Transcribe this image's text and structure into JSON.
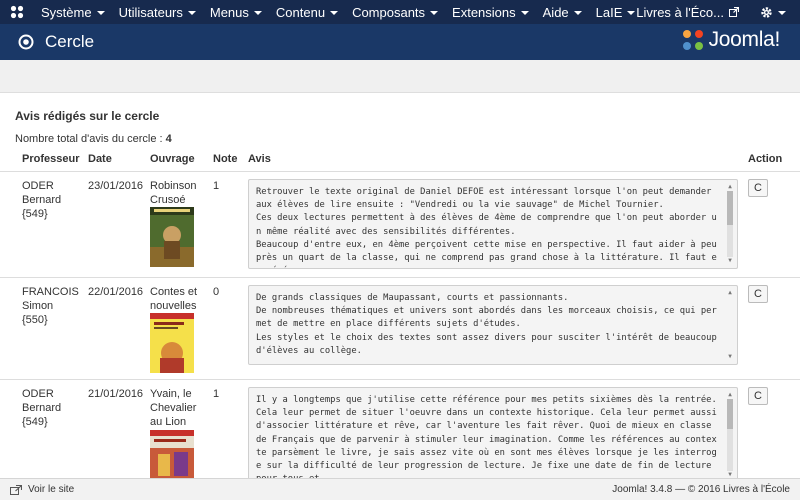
{
  "nav": {
    "logo_icon": "joomla-icon",
    "menus": [
      {
        "label": "Système"
      },
      {
        "label": "Utilisateurs"
      },
      {
        "label": "Menus"
      },
      {
        "label": "Contenu"
      },
      {
        "label": "Composants"
      },
      {
        "label": "Extensions"
      },
      {
        "label": "Aide"
      },
      {
        "label": "LaIE"
      }
    ],
    "site_link": "Livres à l'Éco...",
    "settings_icon": "gear-icon"
  },
  "header": {
    "title": "Cercle",
    "brand": "Joomla!",
    "colors": {
      "navbar": "#172a4e",
      "titlebar": "#1a3867"
    }
  },
  "main": {
    "section_title": "Avis rédigés sur le cercle",
    "total_label": "Nombre total d'avis du cercle :",
    "total_value": "4",
    "columns": {
      "professeur": "Professeur",
      "date": "Date",
      "ouvrage": "Ouvrage",
      "note": "Note",
      "avis": "Avis",
      "action": "Action"
    },
    "rows": [
      {
        "prof_name": "ODER",
        "prof_first": "Bernard",
        "prof_id": "{549}",
        "date": "23/01/2016",
        "book_line1": "Robinson",
        "book_line2": "Crusoé",
        "book_line3": "",
        "note": "1",
        "avis": "Retrouver le texte original de Daniel DEFOE est intéressant lorsque l'on peut demander aux élèves de lire ensuite : \"Vendredi ou la vie sauvage\" de Michel Tournier.\nCes deux lectures permettent à des élèves de 4ème de comprendre que l'on peut aborder un même réalité avec des sensibilités différentes.\nBeaucoup d'entre eux, en 4ème perçoivent cette mise en perspective. Il faut aider à peu près un quart de la classe, qui ne comprend pas grand chose à la littérature. Il faut en génér",
        "action": "C"
      },
      {
        "prof_name": "FRANCOIS",
        "prof_first": "Simon",
        "prof_id": "{550}",
        "date": "22/01/2016",
        "book_line1": "Contes et",
        "book_line2": "nouvelles",
        "book_line3": "",
        "note": "0",
        "avis": "De grands classiques de Maupassant, courts et passionnants.\nDe nombreuses thématiques et univers sont abordés dans les morceaux choisis, ce qui permet de mettre en place différents sujets d'études.\nLes styles et le choix des textes sont assez divers pour susciter l'intérêt de beaucoup d'élèves au collège.",
        "action": "C"
      },
      {
        "prof_name": "ODER",
        "prof_first": "Bernard",
        "prof_id": "{549}",
        "date": "21/01/2016",
        "book_line1": "Yvain, le",
        "book_line2": "Chevalier",
        "book_line3": "au Lion",
        "note": "1",
        "avis": "Il y a longtemps que j'utilise cette référence pour mes petits sixièmes dès la rentrée. Cela leur permet de situer l'oeuvre dans un contexte historique. Cela leur permet aussi d'associer littérature et rêve, car l'aventure les fait rêver. Quoi de mieux en classe de Français que de parvenir à stimuler leur imagination. Comme les références au contexte parsèment le livre, je sais assez vite où en sont mes élèves lorsque je les interroge sur la difficulté de leur progression de lecture. Je fixe une date de fin de lecture pour tous et",
        "action": "C"
      }
    ]
  },
  "footer": {
    "view_site": "Voir le site",
    "version": "Joomla! 3.4.8 — © 2016 Livres à l'École"
  }
}
